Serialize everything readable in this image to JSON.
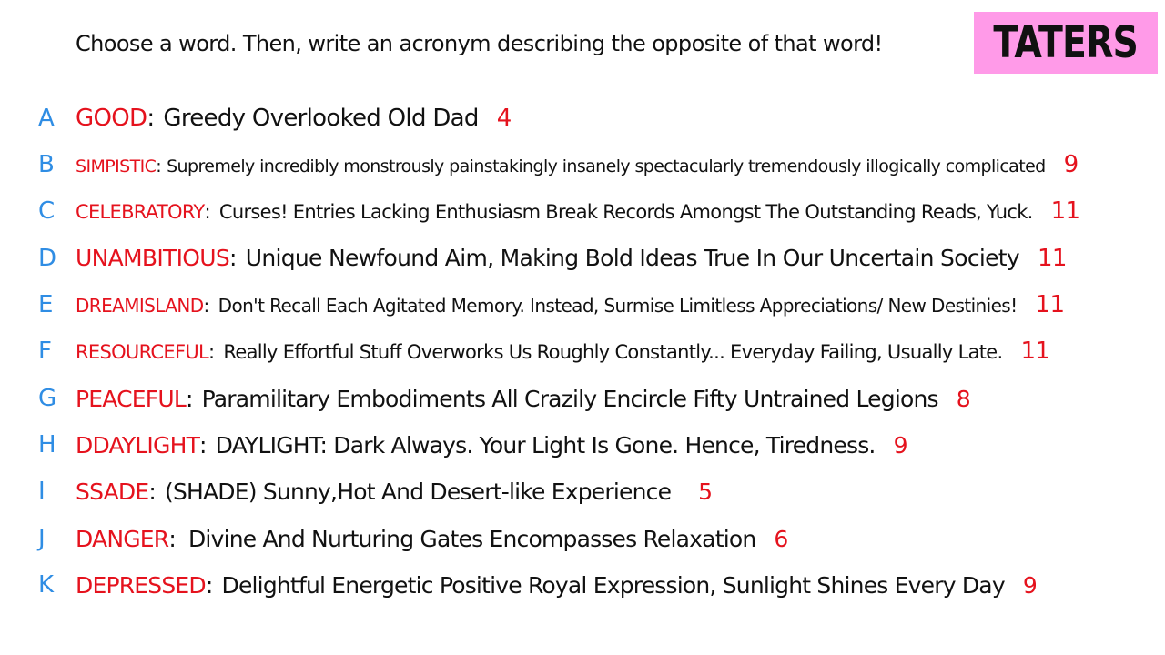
{
  "prompt": "Choose a word. Then, write an acronym describing the opposite of that word!",
  "brand": "TATERS",
  "colors": {
    "letter": "#2f8de4",
    "word": "#e5121d",
    "count": "#e5121d",
    "brand_bg": "#ff9ae8",
    "text": "#111111"
  },
  "entries": [
    {
      "letter": "A",
      "word": "GOOD",
      "colon": ":",
      "acronym": "Greedy Overlooked Old Dad",
      "count": "4"
    },
    {
      "letter": "B",
      "word": "SIMPISTIC",
      "colon": ":",
      "acronym": "Supremely incredibly monstrously painstakingly insanely spectacularly tremendously illogically complicated",
      "count": "9"
    },
    {
      "letter": "C",
      "word": "CELEBRATORY",
      "colon": ":",
      "acronym": "Curses! Entries Lacking Enthusiasm Break Records Amongst The Outstanding Reads, Yuck.",
      "count": "11"
    },
    {
      "letter": "D",
      "word": "UNAMBITIOUS",
      "colon": ":",
      "acronym": "Unique Newfound Aim, Making Bold Ideas True In Our Uncertain Society",
      "count": "11"
    },
    {
      "letter": "E",
      "word": "DREAMISLAND",
      "colon": ":",
      "acronym": "Don't Recall Each Agitated Memory. Instead, Surmise Limitless Appreciations/ New Destinies!",
      "count": "11"
    },
    {
      "letter": "F",
      "word": "RESOURCEFUL",
      "colon": ":",
      "acronym": "Really Effortful Stuff Overworks Us Roughly Constantly... Everyday Failing, Usually Late.",
      "count": "11"
    },
    {
      "letter": "G",
      "word": "PEACEFUL",
      "colon": ":",
      "acronym": "Paramilitary Embodiments All Crazily Encircle Fifty Untrained Legions",
      "count": "8"
    },
    {
      "letter": "H",
      "word": "DDAYLIGHT",
      "colon": ":",
      "acronym": "DAYLIGHT: Dark Always. Your Light Is Gone. Hence, Tiredness.",
      "count": "9"
    },
    {
      "letter": "I",
      "word": "SSADE",
      "colon": ":",
      "acronym": "(SHADE) Sunny,Hot And Desert-like Experience",
      "count": "5"
    },
    {
      "letter": "J",
      "word": "DANGER",
      "colon": ":",
      "acronym": "Divine And Nurturing Gates Encompasses Relaxation",
      "count": "6"
    },
    {
      "letter": "K",
      "word": "DEPRESSED",
      "colon": ":",
      "acronym": "Delightful Energetic Positive Royal Expression, Sunlight Shines Every Day",
      "count": "9"
    }
  ]
}
